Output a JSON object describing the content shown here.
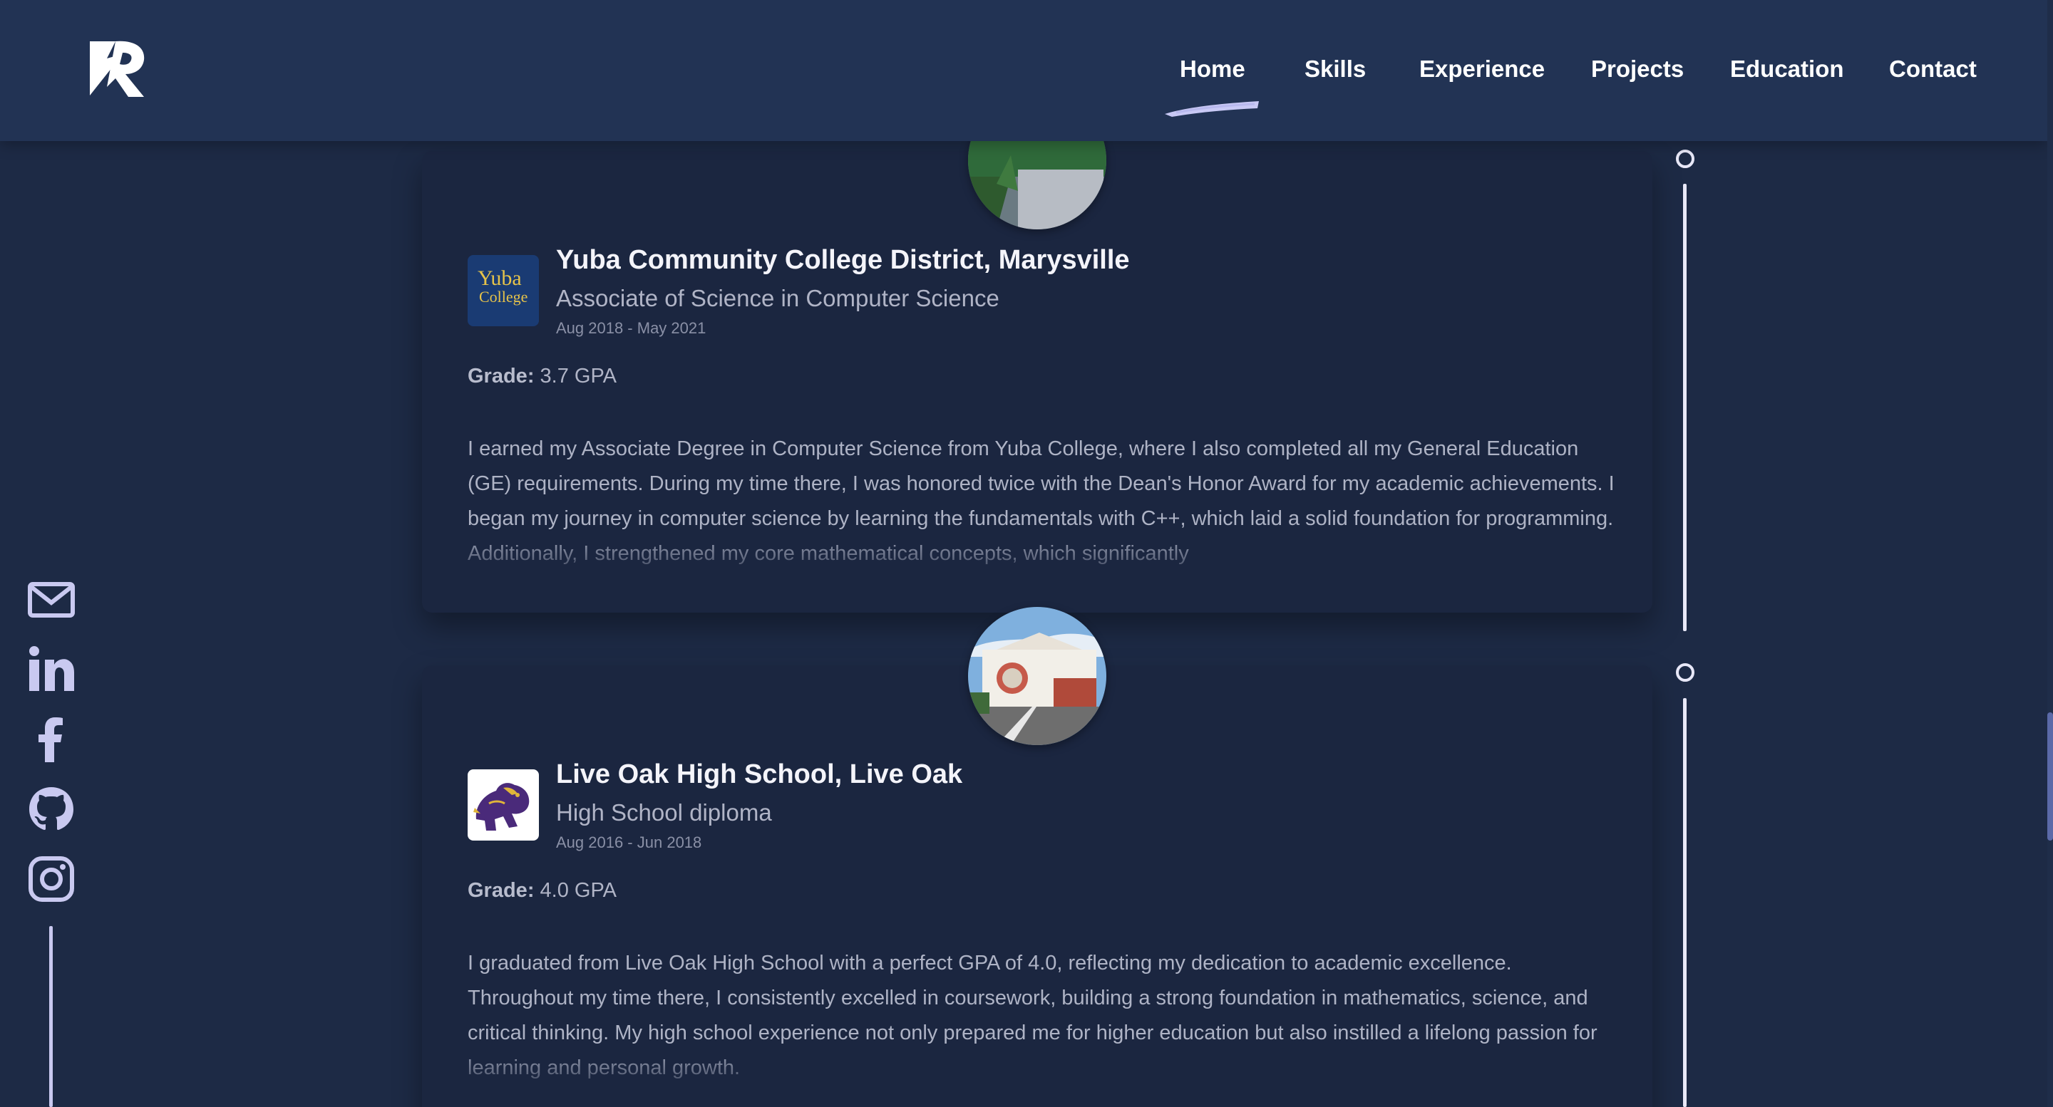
{
  "header": {
    "logo_icon": "r-logo-icon",
    "nav": [
      {
        "label": "Home",
        "active": true
      },
      {
        "label": "Skills"
      },
      {
        "label": "Experience"
      },
      {
        "label": "Projects"
      },
      {
        "label": "Education"
      },
      {
        "label": "Contact"
      }
    ],
    "accent_color": "#c9c9f5"
  },
  "social": [
    "mail-icon",
    "linkedin-icon",
    "facebook-icon",
    "github-icon",
    "instagram-icon"
  ],
  "education": [
    {
      "school": "Yuba Community College District, Marysville",
      "degree": "Associate of Science in Computer Science",
      "dates": "Aug 2018 - May 2021",
      "grade_label": "Grade:",
      "grade_value": "3.7 GPA",
      "description": "I earned my Associate Degree in Computer Science from Yuba College, where I also completed all my General Education (GE) requirements. During my time there, I was honored twice with the Dean's Honor Award for my academic achievements. I began my journey in computer science by learning the fundamentals with C++, which laid a solid foundation for programming. Additionally, I strengthened my core mathematical concepts, which significantly",
      "logo_text_1": "Yuba",
      "logo_text_2": "College"
    },
    {
      "school": "Live Oak High School, Live Oak",
      "degree": "High School diploma",
      "dates": "Aug 2016 - Jun 2018",
      "grade_label": "Grade:",
      "grade_value": "4.0 GPA",
      "description": "I graduated from Live Oak High School with a perfect GPA of 4.0, reflecting my dedication to academic excellence. Throughout my time there, I consistently excelled in coursework, building a strong foundation in mathematics, science, and critical thinking. My high school experience not only prepared me for higher education but also instilled a lifelong passion for learning and personal growth."
    }
  ]
}
